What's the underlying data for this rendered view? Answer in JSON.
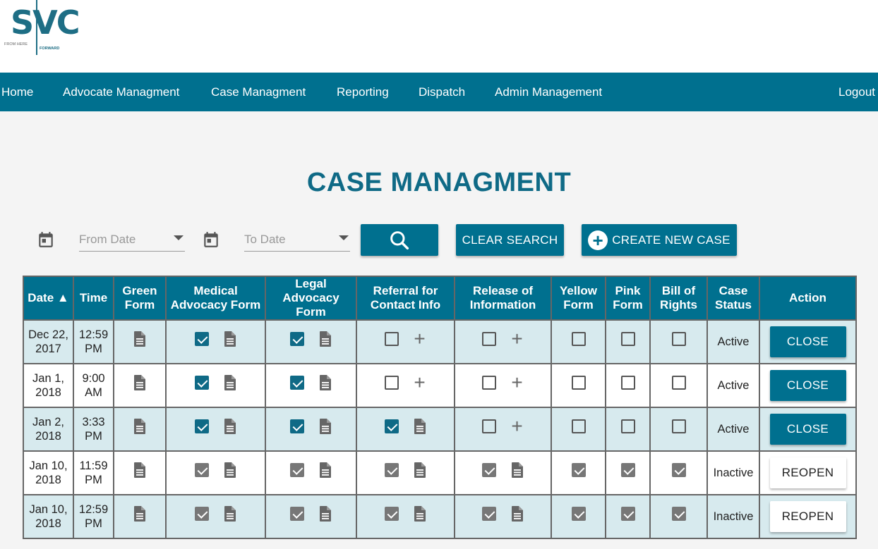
{
  "brand": {
    "logo_text": "SVC",
    "tagline_left": "FROM HERE",
    "tagline_right": "FORWARD",
    "color": "#1e6e85"
  },
  "nav": {
    "items": [
      "Home",
      "Advocate Managment",
      "Case Managment",
      "Reporting",
      "Dispatch",
      "Admin Management"
    ],
    "logout": "Logout"
  },
  "page": {
    "title": "CASE MANAGMENT"
  },
  "search": {
    "from_placeholder": "From Date",
    "to_placeholder": "To Date",
    "search_icon": "search-icon",
    "clear_label": "CLEAR SEARCH",
    "create_label": "CREATE NEW CASE"
  },
  "table": {
    "headers": {
      "date": "Date ▲",
      "time": "Time",
      "green": [
        "Green",
        "Form"
      ],
      "medical": [
        "Medical",
        "Advocacy Form"
      ],
      "legal": [
        "Legal",
        "Advocacy",
        "Form"
      ],
      "referral": [
        "Referral for",
        "Contact Info"
      ],
      "release": [
        "Release of",
        "Information"
      ],
      "yellow": [
        "Yellow",
        "Form"
      ],
      "pink": [
        "Pink",
        "Form"
      ],
      "bill": [
        "Bill of",
        "Rights"
      ],
      "status": [
        "Case",
        "Status"
      ],
      "action": "Action"
    },
    "rows": [
      {
        "date": [
          "Dec 22,",
          "2017"
        ],
        "time": [
          "12:59",
          "PM"
        ],
        "medical": "checked",
        "legal": "checked",
        "referral": "unchecked",
        "release": "unchecked",
        "yellow": "unchecked",
        "pink": "unchecked",
        "bill": "unchecked",
        "status": "Active",
        "action": "CLOSE"
      },
      {
        "date": [
          "Jan 1,",
          "2018"
        ],
        "time": [
          "9:00",
          "AM"
        ],
        "medical": "checked",
        "legal": "checked",
        "referral": "unchecked",
        "release": "unchecked",
        "yellow": "unchecked",
        "pink": "unchecked",
        "bill": "unchecked",
        "status": "Active",
        "action": "CLOSE"
      },
      {
        "date": [
          "Jan 2,",
          "2018"
        ],
        "time": [
          "3:33",
          "PM"
        ],
        "medical": "checked",
        "legal": "checked",
        "referral": "checked",
        "release": "unchecked",
        "yellow": "unchecked",
        "pink": "unchecked",
        "bill": "unchecked",
        "status": "Active",
        "action": "CLOSE"
      },
      {
        "date": [
          "Jan 10,",
          "2018"
        ],
        "time": [
          "11:59",
          "PM"
        ],
        "medical": "disabled-checked",
        "legal": "disabled-checked",
        "referral": "disabled-checked",
        "release": "disabled-checked",
        "yellow": "disabled-checked",
        "pink": "disabled-checked",
        "bill": "disabled-checked",
        "status": "Inactive",
        "action": "REOPEN"
      },
      {
        "date": [
          "Jan 10,",
          "2018"
        ],
        "time": [
          "12:59",
          "PM"
        ],
        "medical": "disabled-checked",
        "legal": "disabled-checked",
        "referral": "disabled-checked",
        "release": "disabled-checked",
        "yellow": "disabled-checked",
        "pink": "disabled-checked",
        "bill": "disabled-checked",
        "status": "Inactive",
        "action": "REOPEN"
      }
    ]
  },
  "colors": {
    "primary": "#00708f",
    "title": "#0f6a86",
    "row_shade": "#d7eaee",
    "checked": "#0f6a86",
    "disabled": "#777777"
  }
}
